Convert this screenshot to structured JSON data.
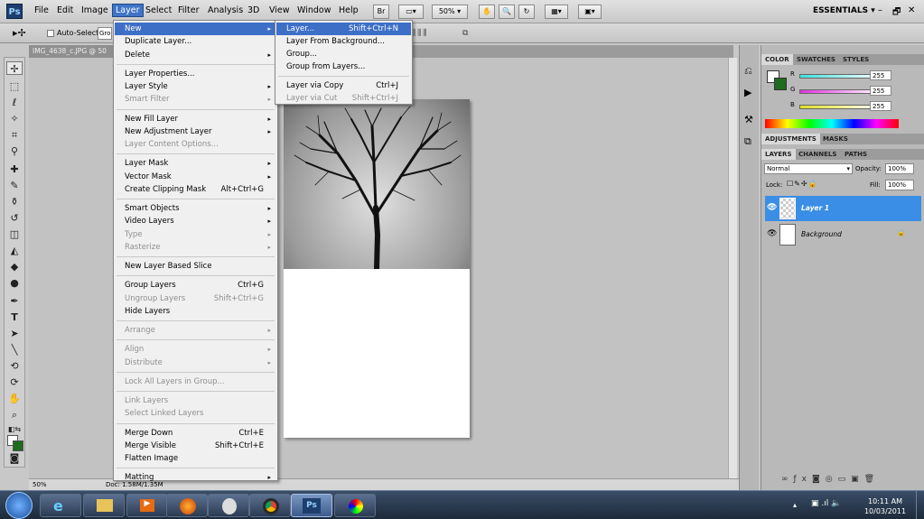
{
  "app": {
    "logo": "Ps",
    "zoom": "50%",
    "workspace": "ESSENTIALS",
    "window_controls": [
      "–",
      "🗗",
      "✕"
    ]
  },
  "menubar": [
    "File",
    "Edit",
    "Image",
    "Layer",
    "Select",
    "Filter",
    "Analysis",
    "3D",
    "View",
    "Window",
    "Help"
  ],
  "options_bar": {
    "auto_select_label": "Auto-Select:",
    "auto_select_value": "Grou"
  },
  "document": {
    "tab": "IMG_4638_c.JPG @ 50",
    "status_zoom": "50%",
    "status_doc": "Doc: 1.58M/1.35M"
  },
  "layer_menu": {
    "items": [
      {
        "label": "New",
        "arrow": "▸",
        "highlight": true
      },
      {
        "label": "Duplicate Layer..."
      },
      {
        "label": "Delete",
        "arrow": "▸"
      },
      {
        "sep": true
      },
      {
        "label": "Layer Properties..."
      },
      {
        "label": "Layer Style",
        "arrow": "▸"
      },
      {
        "label": "Smart Filter",
        "arrow": "▸",
        "disabled": true
      },
      {
        "sep": true
      },
      {
        "label": "New Fill Layer",
        "arrow": "▸"
      },
      {
        "label": "New Adjustment Layer",
        "arrow": "▸"
      },
      {
        "label": "Layer Content Options...",
        "disabled": true
      },
      {
        "sep": true
      },
      {
        "label": "Layer Mask",
        "arrow": "▸"
      },
      {
        "label": "Vector Mask",
        "arrow": "▸"
      },
      {
        "label": "Create Clipping Mask",
        "shortcut": "Alt+Ctrl+G"
      },
      {
        "sep": true
      },
      {
        "label": "Smart Objects",
        "arrow": "▸"
      },
      {
        "label": "Video Layers",
        "arrow": "▸"
      },
      {
        "label": "Type",
        "arrow": "▸",
        "disabled": true
      },
      {
        "label": "Rasterize",
        "arrow": "▸",
        "disabled": true
      },
      {
        "sep": true
      },
      {
        "label": "New Layer Based Slice"
      },
      {
        "sep": true
      },
      {
        "label": "Group Layers",
        "shortcut": "Ctrl+G"
      },
      {
        "label": "Ungroup Layers",
        "shortcut": "Shift+Ctrl+G",
        "disabled": true
      },
      {
        "label": "Hide Layers"
      },
      {
        "sep": true
      },
      {
        "label": "Arrange",
        "arrow": "▸",
        "disabled": true
      },
      {
        "sep": true
      },
      {
        "label": "Align",
        "arrow": "▸",
        "disabled": true
      },
      {
        "label": "Distribute",
        "arrow": "▸",
        "disabled": true
      },
      {
        "sep": true
      },
      {
        "label": "Lock All Layers in Group...",
        "disabled": true
      },
      {
        "sep": true
      },
      {
        "label": "Link Layers",
        "disabled": true
      },
      {
        "label": "Select Linked Layers",
        "disabled": true
      },
      {
        "sep": true
      },
      {
        "label": "Merge Down",
        "shortcut": "Ctrl+E"
      },
      {
        "label": "Merge Visible",
        "shortcut": "Shift+Ctrl+E"
      },
      {
        "label": "Flatten Image"
      },
      {
        "sep": true
      },
      {
        "label": "Matting",
        "arrow": "▸"
      }
    ]
  },
  "new_submenu": {
    "items": [
      {
        "label": "Layer...",
        "shortcut": "Shift+Ctrl+N",
        "highlight": true
      },
      {
        "label": "Layer From Background..."
      },
      {
        "label": "Group..."
      },
      {
        "label": "Group from Layers..."
      },
      {
        "sep": true
      },
      {
        "label": "Layer via Copy",
        "shortcut": "Ctrl+J"
      },
      {
        "label": "Layer via Cut",
        "shortcut": "Shift+Ctrl+J",
        "disabled": true
      }
    ]
  },
  "color_panel": {
    "tabs": [
      "COLOR",
      "SWATCHES",
      "STYLES"
    ],
    "channels": [
      {
        "name": "R",
        "value": "255",
        "color": "#ff2020"
      },
      {
        "name": "G",
        "value": "255",
        "color": "#20c020"
      },
      {
        "name": "B",
        "value": "255",
        "color": "#2040ff"
      }
    ]
  },
  "adjustments_panel": {
    "tabs": [
      "ADJUSTMENTS",
      "MASKS"
    ]
  },
  "layers_panel": {
    "tabs": [
      "LAYERS",
      "CHANNELS",
      "PATHS"
    ],
    "blend_mode": "Normal",
    "opacity_label": "Opacity:",
    "opacity": "100%",
    "lock_label": "Lock:",
    "fill_label": "Fill:",
    "fill": "100%",
    "layers": [
      {
        "name": "Layer 1",
        "selected": true
      },
      {
        "name": "Background",
        "locked": true
      }
    ]
  },
  "taskbar": {
    "time": "10:11 AM",
    "date": "10/03/2011",
    "ps_label": "Ps"
  },
  "colors": {
    "accent": "#3d6fc7",
    "layer_selected": "#3a8ee6"
  }
}
